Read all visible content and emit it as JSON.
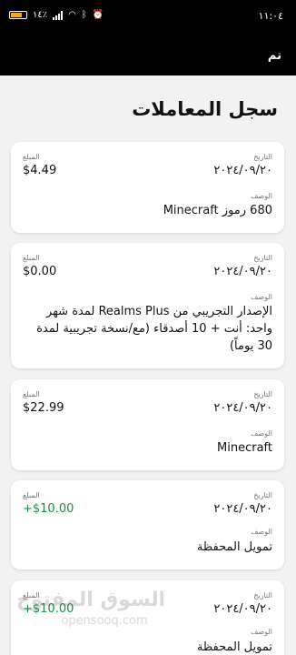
{
  "status": {
    "time": "١١:٠٤",
    "battery": "١٤٪"
  },
  "topbar": {
    "done_label": "تم"
  },
  "page_title": "سجل المعاملات",
  "labels": {
    "date": "التاريخ",
    "amount": "المبلغ",
    "description": "الوصف"
  },
  "transactions": [
    {
      "date": "٢٠٢٤/٠٩/٢٠",
      "amount": "$4.49",
      "description": "680 رموز Minecraft"
    },
    {
      "date": "٢٠٢٤/٠٩/٢٠",
      "amount": "$0.00",
      "description": "الإصدار التجريبي من Realms Plus لمدة شهر واحد: أنت + 10 أصدقاء (مع/نسخة تجريبية لمدة 30 يوماً)"
    },
    {
      "date": "٢٠٢٤/٠٩/٢٠",
      "amount": "$22.99",
      "description": "Minecraft"
    },
    {
      "date": "٢٠٢٤/٠٩/٢٠",
      "amount": "+$10.00",
      "description": "تمويل المحفظة",
      "amount_color": "#1f8a4c"
    },
    {
      "date": "٢٠٢٤/٠٩/٢٠",
      "amount": "+$10.00",
      "description": "تمويل المحفظة",
      "amount_color": "#1f8a4c"
    }
  ],
  "watermark": {
    "arabic": "السوق المفتوح",
    "latin": "opensooq.com"
  }
}
